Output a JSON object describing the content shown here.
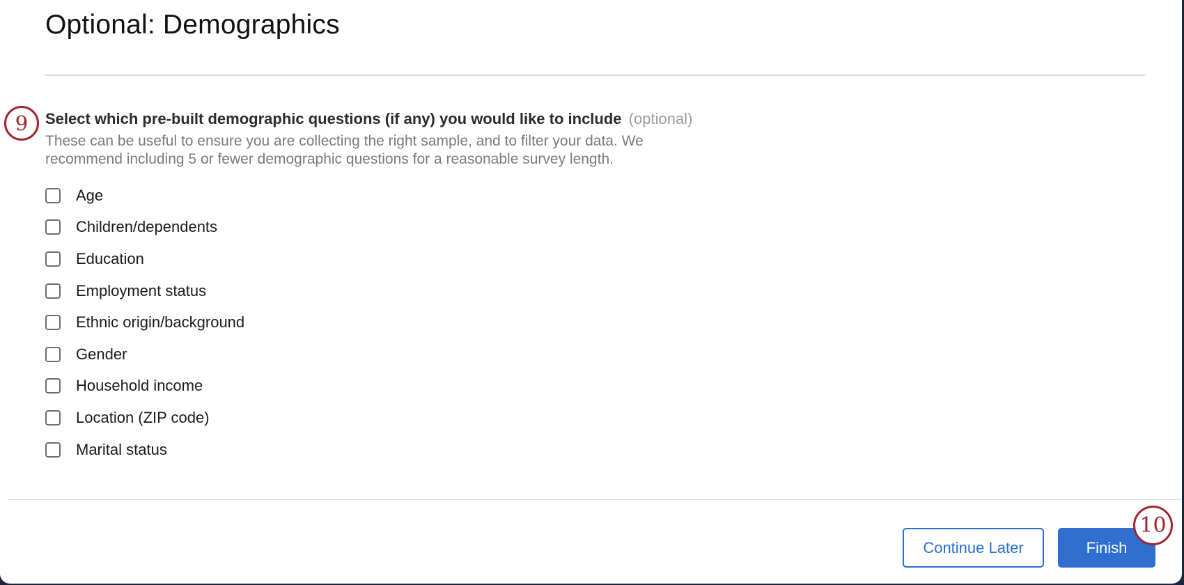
{
  "page": {
    "title": "Optional: Demographics"
  },
  "question": {
    "step_number": "9",
    "text": "Select which pre-built demographic questions (if any) you would like to include",
    "optional_tag": "(optional)",
    "help_line_1": "These can be useful to ensure you are collecting the right sample, and to filter your data. We",
    "help_line_2": "recommend including 5 or fewer demographic questions for a reasonable survey length."
  },
  "options": [
    {
      "label": "Age",
      "checked": false
    },
    {
      "label": "Children/dependents",
      "checked": false
    },
    {
      "label": "Education",
      "checked": false
    },
    {
      "label": "Employment status",
      "checked": false
    },
    {
      "label": "Ethnic origin/background",
      "checked": false
    },
    {
      "label": "Gender",
      "checked": false
    },
    {
      "label": "Household income",
      "checked": false
    },
    {
      "label": "Location (ZIP code)",
      "checked": false
    },
    {
      "label": "Marital status",
      "checked": false
    }
  ],
  "footer": {
    "continue_label": "Continue Later",
    "finish_label": "Finish",
    "finish_step_number": "10"
  },
  "colors": {
    "accent": "#2f6fd0",
    "badge": "#a3232f"
  }
}
